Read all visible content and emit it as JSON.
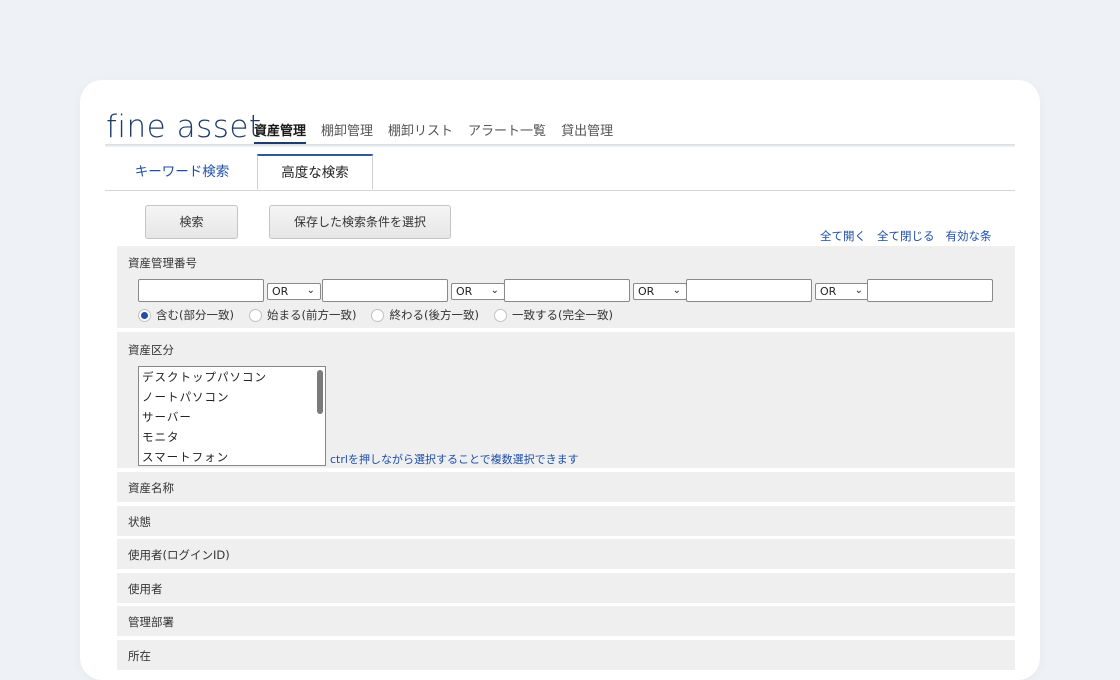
{
  "app": {
    "logo": "fine asset"
  },
  "nav": {
    "items": [
      {
        "label": "資産管理",
        "active": true
      },
      {
        "label": "棚卸管理",
        "active": false
      },
      {
        "label": "棚卸リスト",
        "active": false
      },
      {
        "label": "アラート一覧",
        "active": false
      },
      {
        "label": "貸出管理",
        "active": false
      }
    ]
  },
  "tabs": {
    "keyword": "キーワード検索",
    "advanced": "高度な検索"
  },
  "toolbar": {
    "search_label": "検索",
    "saved_label": "保存した検索条件を選択"
  },
  "links": {
    "open_all": "全て開く",
    "close_all": "全て閉じる",
    "enabled": "有効な条"
  },
  "asset_number": {
    "label": "資産管理番号",
    "operators": [
      "OR",
      "OR",
      "OR",
      "OR"
    ],
    "inputs": [
      "",
      "",
      "",
      "",
      ""
    ],
    "match_modes": [
      {
        "label": "含む(部分一致)",
        "selected": true
      },
      {
        "label": "始まる(前方一致)",
        "selected": false
      },
      {
        "label": "終わる(後方一致)",
        "selected": false
      },
      {
        "label": "一致する(完全一致)",
        "selected": false
      }
    ]
  },
  "asset_kind": {
    "label": "資産区分",
    "options": [
      "デスクトップパソコン",
      "ノートパソコン",
      "サーバー",
      "モニタ",
      "スマートフォン"
    ],
    "hint": "ctrlを押しながら選択することで複数選択できます"
  },
  "sections": [
    {
      "label": "資産名称"
    },
    {
      "label": "状態"
    },
    {
      "label": "使用者(ログインID)"
    },
    {
      "label": "使用者"
    },
    {
      "label": "管理部署"
    },
    {
      "label": "所在"
    }
  ],
  "colors": {
    "accent": "#1e4ea8",
    "brand": "#1d3c6a",
    "section_bg": "#efefef",
    "page_bg": "#eef1f6"
  },
  "icons": {
    "select_chevron": "chevron-down-icon"
  }
}
